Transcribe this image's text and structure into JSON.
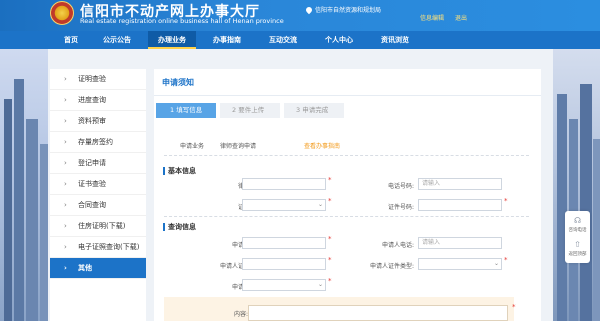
{
  "header": {
    "title": "信阳市不动产网上办事大厅",
    "subtitle": "Real estate registration online business hall of Henan province",
    "location": "信阳市自然资源和规划局",
    "user": "信息编辑",
    "logout": "退出"
  },
  "nav": [
    "首页",
    "公示公告",
    "办理业务",
    "办事指南",
    "互动交流",
    "个人中心",
    "资讯浏览"
  ],
  "sidebar": [
    {
      "label": "证明查验"
    },
    {
      "label": "进度查询"
    },
    {
      "label": "资料预审"
    },
    {
      "label": "存量房签约"
    },
    {
      "label": "登记申请"
    },
    {
      "label": "证书查验"
    },
    {
      "label": "合同查询"
    },
    {
      "label": "住房证明(下载)"
    },
    {
      "label": "电子证照查询(下载)"
    },
    {
      "label": "其他"
    }
  ],
  "panel": {
    "title": "申请须知",
    "steps": [
      "1  填写信息",
      "2  要件上传",
      "3  申请完成"
    ],
    "business_label": "申请业务",
    "business_value": "律师查询申请",
    "guide_link": "查看办事指南",
    "section_basic": "基本信息",
    "section_query": "查询信息",
    "lawyer_name": "律师名称:",
    "phone": "电话号码:",
    "phone_placeholder": "请输入",
    "id_type": "证件类型:",
    "id_number": "证件号码:",
    "applicant_name": "申请人姓名:",
    "applicant_phone": "申请人电话:",
    "applicant_phone_placeholder": "请输入",
    "applicant_id_number": "申请人证件号码:",
    "applicant_id_type": "申请人证件类型:",
    "applicant_type": "申请人类型:",
    "content": "内容:"
  },
  "float": {
    "consult": "咨询电话",
    "back_top": "返回顶部"
  },
  "colors": {
    "primary": "#1c73c8",
    "accent": "#f39a1a",
    "required": "#e53935"
  }
}
